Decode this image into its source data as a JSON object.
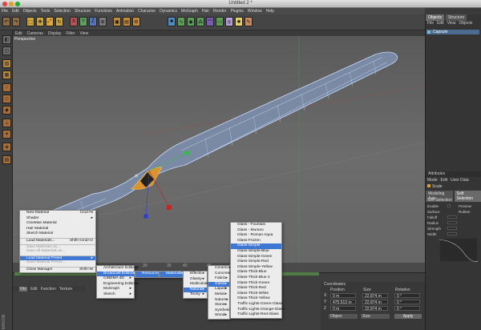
{
  "window": {
    "title": "Untitled 2 *"
  },
  "menubar": [
    "File",
    "Edit",
    "Objects",
    "Tools",
    "Selection",
    "Structure",
    "Functions",
    "Animation",
    "Character",
    "Dynamics",
    "MoGraph",
    "Hair",
    "Render",
    "Plugins",
    "Window",
    "Help"
  ],
  "viewport": {
    "label": "Perspective",
    "menu": [
      "Edit",
      "Cameras",
      "Display",
      "Filter",
      "View"
    ]
  },
  "right_panel": {
    "tabs": [
      "Objects",
      "Structure"
    ],
    "menu": [
      "File",
      "Edit",
      "View",
      "Objects"
    ],
    "object_name": "Capsule",
    "attributes_title": "Attributes",
    "attributes_menu": [
      "Mode",
      "Edit",
      "User Data"
    ],
    "attributes_object": "Scale",
    "attributes_tabs": [
      "Modeling Axis",
      "Soft Selection"
    ],
    "section": "Soft Selection",
    "fields": [
      "Enable",
      "Surface",
      "Falloff",
      "Radius",
      "Strength",
      "Width"
    ],
    "field_right": [
      "Preview",
      "Rubber"
    ]
  },
  "timeline": {
    "ticks": [
      "30",
      "35",
      "40",
      "45"
    ]
  },
  "material_manager": {
    "menu": [
      "File",
      "Edit",
      "Function",
      "Texture"
    ]
  },
  "coordinates": {
    "title": "Coordinates",
    "headers": [
      "Position",
      "Size",
      "Rotation"
    ],
    "rows": [
      {
        "axis": "X",
        "pos": "0 m",
        "size": "22.874 m",
        "rot": "0 °"
      },
      {
        "axis": "Y",
        "pos": "475.513 m",
        "size": "22.874 m",
        "rot": "0 °"
      },
      {
        "axis": "Z",
        "pos": "0 m",
        "size": "22.874 m",
        "rot": "0 °"
      }
    ],
    "mode_left": "Object",
    "mode_mid": "Size",
    "apply": "Apply"
  },
  "menu_file": [
    {
      "label": "New Material",
      "shortcut": "Cmd+N",
      "icon": true
    },
    {
      "label": "Shader",
      "arrow": true
    },
    {
      "label": "CineMan Material"
    },
    {
      "label": "Hair Material"
    },
    {
      "label": "Sketch Material"
    },
    {
      "label": "Load Materials...",
      "shortcut": "Shift+Cmd+O",
      "sep": true,
      "icon": true
    },
    {
      "label": "Save Materials as...",
      "dim": true,
      "sep": true
    },
    {
      "label": "Save All Materials as...",
      "dim": true
    },
    {
      "label": "Load Material Preset",
      "arrow": true,
      "hl": true,
      "sep": true
    },
    {
      "label": "Save Material Preset...",
      "dim": true
    },
    {
      "label": "Close Manager",
      "shortcut": "Shift+W",
      "sep": true,
      "icon": true
    }
  ],
  "menu_preset": [
    {
      "label": "Architecture Edition",
      "arrow": true
    },
    {
      "label": "Broadcast Edition",
      "arrow": true,
      "hl": true
    },
    {
      "label": "CINEMA 4D",
      "arrow": true
    },
    {
      "label": "Engineering Edition",
      "arrow": true
    },
    {
      "label": "MoGraph",
      "arrow": true
    },
    {
      "label": "Sketch",
      "arrow": true
    }
  ],
  "menu_broadcast": [
    {
      "label": "Resources",
      "arrow": true,
      "hl": true
    }
  ],
  "menu_resources": [
    {
      "label": "Materials",
      "arrow": true,
      "hl": true
    }
  ],
  "menu_materials": [
    {
      "label": "Effects",
      "arrow": true
    },
    {
      "label": "Glassy",
      "arrow": true
    },
    {
      "label": "Multicolor",
      "arrow": true
    },
    {
      "label": "Natural",
      "arrow": true,
      "hl": true
    },
    {
      "label": "Toony",
      "arrow": true
    }
  ],
  "menu_natural": [
    {
      "label": "Ceramic",
      "arrow": true
    },
    {
      "label": "Concrete",
      "arrow": true
    },
    {
      "label": "Fabric",
      "arrow": true
    },
    {
      "label": "Glass",
      "arrow": true,
      "hl": true
    },
    {
      "label": "Liquid",
      "arrow": true
    },
    {
      "label": "Metal",
      "arrow": true
    },
    {
      "label": "Nature",
      "arrow": true
    },
    {
      "label": "Stone",
      "arrow": true
    },
    {
      "label": "Synthetic",
      "arrow": true
    },
    {
      "label": "Wood",
      "arrow": true
    }
  ],
  "menu_glass": [
    {
      "label": "Glass - Fountain"
    },
    {
      "label": "Glass - Murano"
    },
    {
      "label": "Glass - Roman Aqua"
    },
    {
      "label": "Glass-Frozen"
    },
    {
      "label": "Glass-Simple",
      "hl": true
    },
    {
      "label": "Glass-Simple-Blue"
    },
    {
      "label": "Glass-Simple-Green"
    },
    {
      "label": "Glass-Simple-Red"
    },
    {
      "label": "Glass-Simple-Yellow"
    },
    {
      "label": "Glass-Thick-Blue"
    },
    {
      "label": "Glass-Thick-Blue 2"
    },
    {
      "label": "Glass-Thick-Green"
    },
    {
      "label": "Glass-Thick-Red"
    },
    {
      "label": "Glass-Thick-White"
    },
    {
      "label": "Glass-Thick-Yellow"
    },
    {
      "label": "Traffic-Lights-Green-Glass"
    },
    {
      "label": "Traffic-Lights-Orange-Glass"
    },
    {
      "label": "Traffic-Lights-Red-Glass"
    }
  ]
}
